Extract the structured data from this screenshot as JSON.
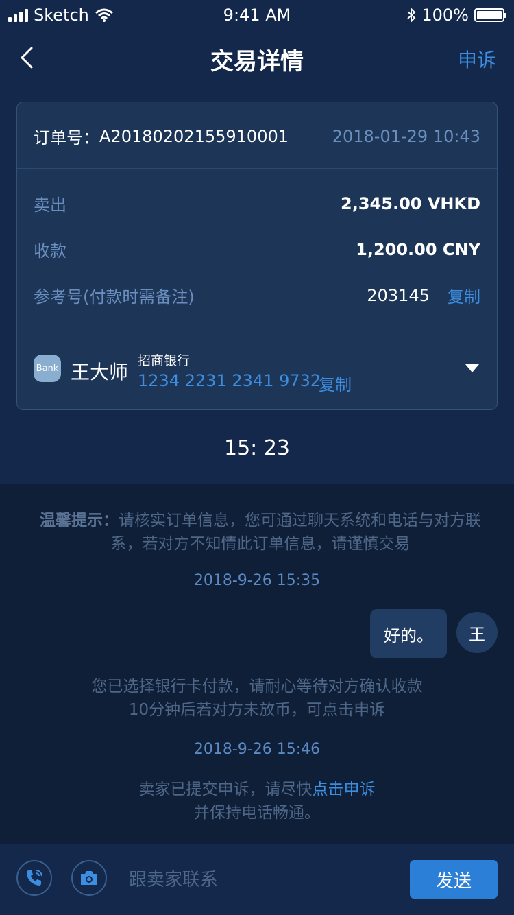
{
  "status_bar": {
    "carrier": "Sketch",
    "time": "9:41 AM",
    "battery": "100%"
  },
  "nav": {
    "title": "交易详情",
    "appeal_label": "申诉"
  },
  "order": {
    "number_label": "订单号：",
    "number": "A20180202155910001",
    "datetime": "2018-01-29 10:43",
    "sell_label": "卖出",
    "sell_value": "2,345.00 VHKD",
    "receive_label": "收款",
    "receive_value": "1,200.00 CNY",
    "ref_label": "参考号(付款时需备注)",
    "ref_value": "203145",
    "copy_label": "复制"
  },
  "bank": {
    "icon_text": "Bank",
    "holder": "王大师",
    "name": "招商银行",
    "account": "1234 2231 2341 9732",
    "copy_label": "复制"
  },
  "countdown": "15: 23",
  "chat": {
    "notice_title": "温馨提示：",
    "notice_text": "请核实订单信息，您可通过聊天系统和电话与对方联系，若对方不知情此订单信息，请谨慎交易",
    "stamp1": "2018-9-26 15:35",
    "message": "好的。",
    "avatar_text": "王",
    "sys1_line1": "您已选择银行卡付款，请耐心等待对方确认收款",
    "sys1_line2": "10分钟后若对方未放币，可点击申诉",
    "stamp2": "2018-9-26 15:46",
    "sys2_prefix": "卖家已提交申诉，请尽快",
    "sys2_link": "点击申诉",
    "sys2_line2": "并保持电话畅通。"
  },
  "composer": {
    "placeholder": "跟卖家联系",
    "send_label": "发送"
  },
  "colors": {
    "accent": "#3d8de0",
    "background": "#0f1f37",
    "card": "#1d3557"
  }
}
